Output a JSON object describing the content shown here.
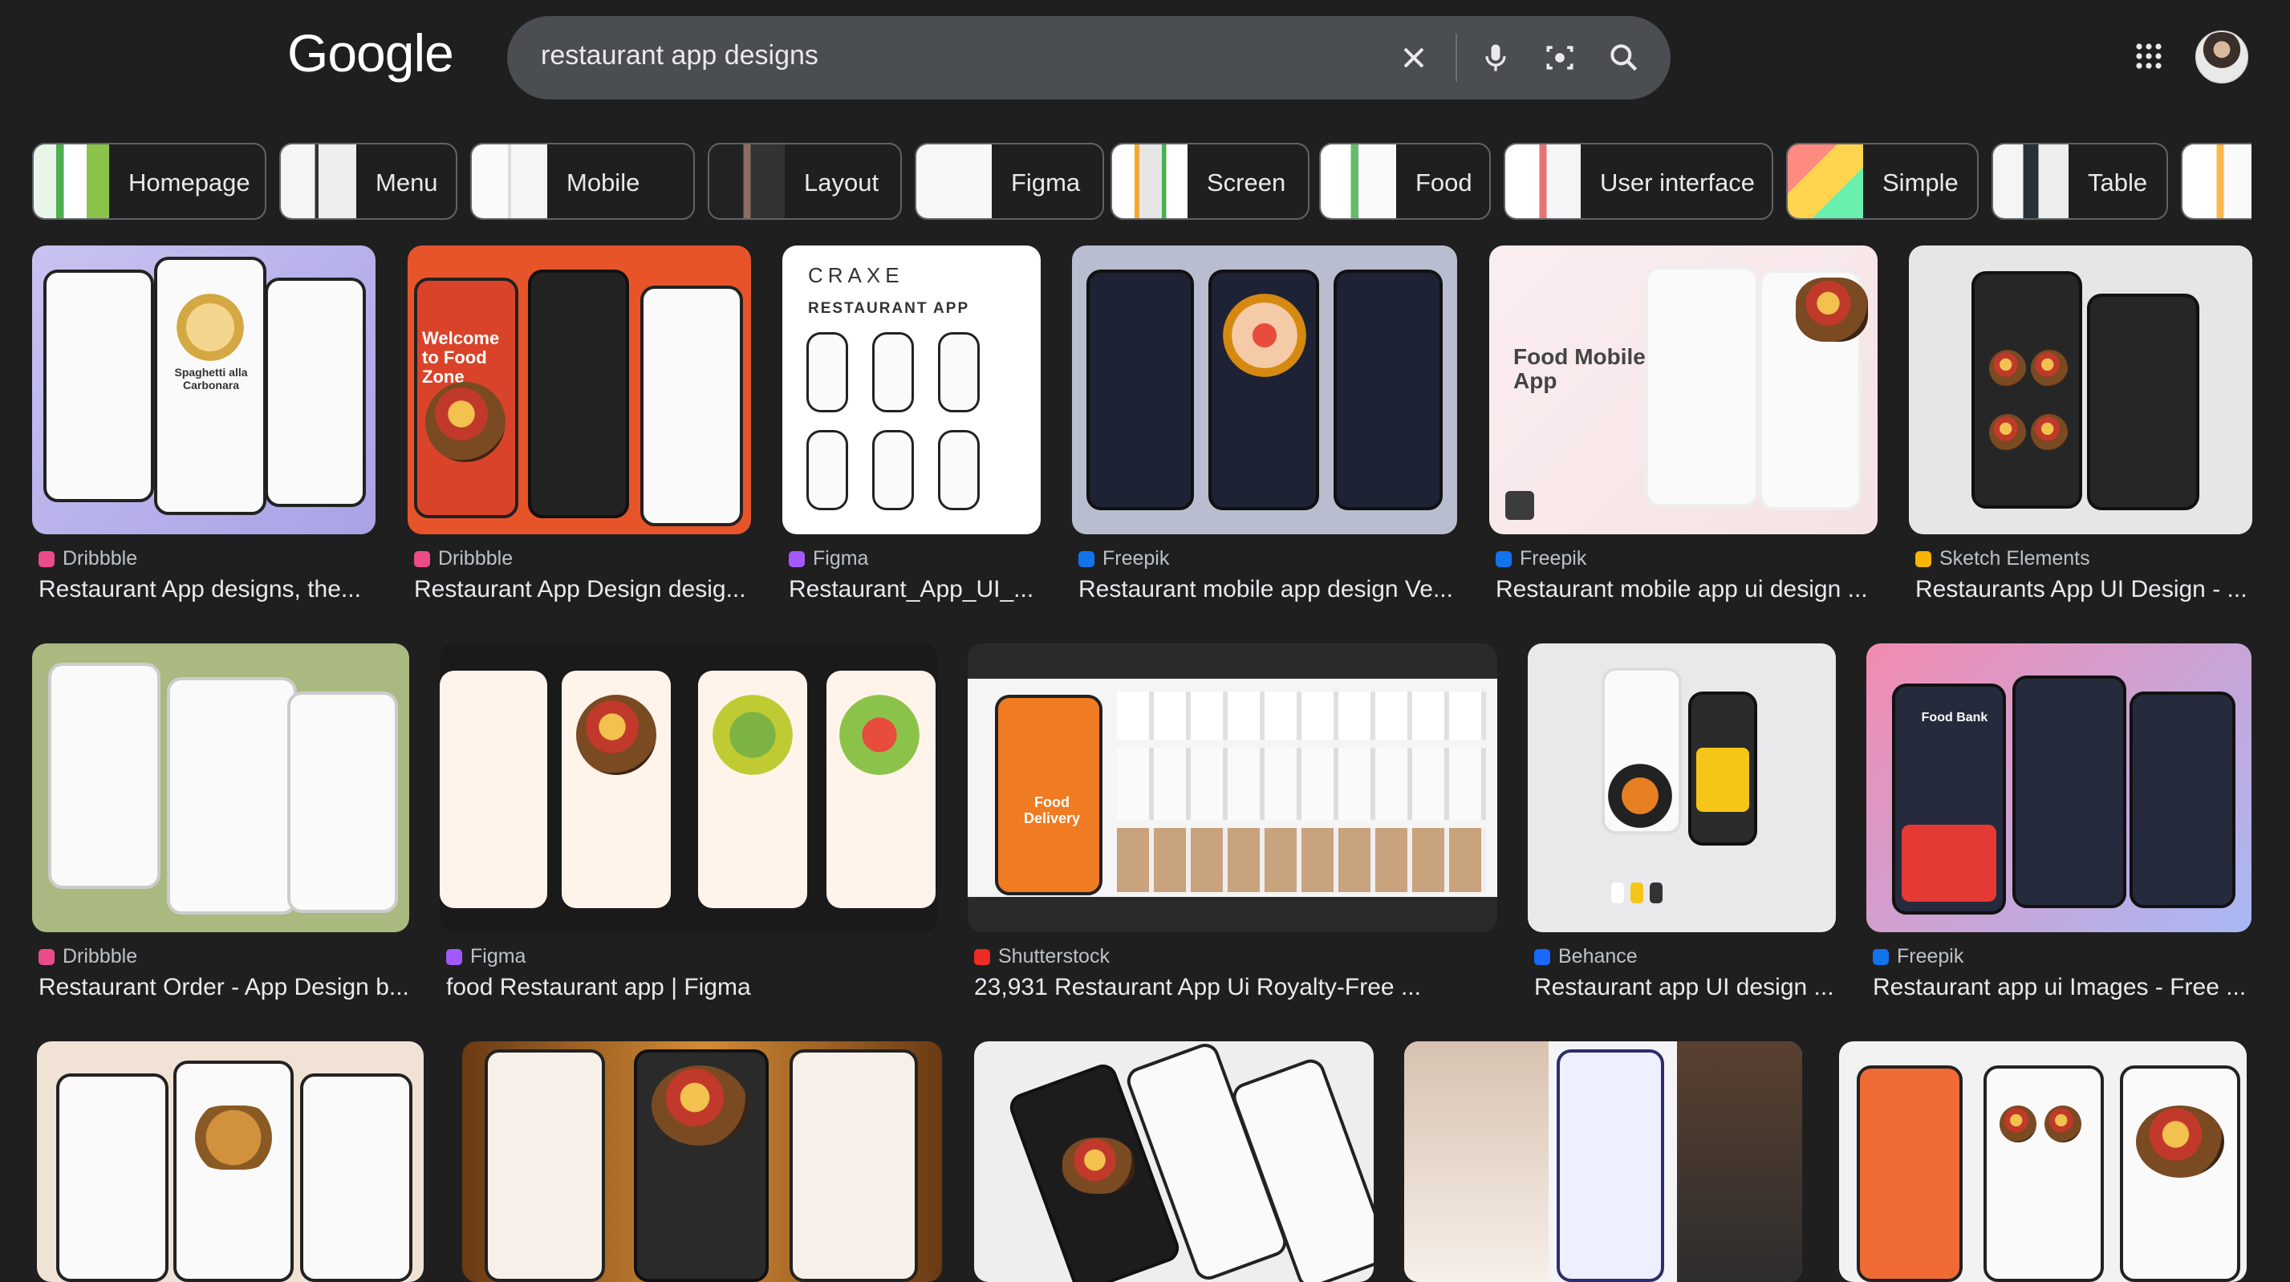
{
  "header": {
    "logo": "Google",
    "search_value": "restaurant app designs"
  },
  "chips": [
    {
      "label": "Homepage"
    },
    {
      "label": "Menu"
    },
    {
      "label": "Mobile"
    },
    {
      "label": "Layout"
    },
    {
      "label": "Figma"
    },
    {
      "label": "Screen"
    },
    {
      "label": "Food"
    },
    {
      "label": "User interface"
    },
    {
      "label": "Simple"
    },
    {
      "label": "Table"
    }
  ],
  "results": [
    {
      "source": "Dribbble",
      "title": "Restaurant App designs, the...",
      "fav_color": "#ea4c89",
      "thumb_text": "Spaghetti alla Carbonara"
    },
    {
      "source": "Dribbble",
      "title": "Restaurant App Design desig...",
      "fav_color": "#ea4c89",
      "thumb_text": "Welcome to Food Zone"
    },
    {
      "source": "Figma",
      "title": "Restaurant_App_UI_...",
      "fav_color": "#a259ff",
      "thumb_text": "RESTAURANT APP",
      "thumb_brand": "CRAXE"
    },
    {
      "source": "Freepik",
      "title": "Restaurant mobile app design Ve...",
      "fav_color": "#1273eb"
    },
    {
      "source": "Freepik",
      "title": "Restaurant mobile app ui design ...",
      "fav_color": "#1273eb",
      "thumb_text": "Food Mobile App"
    },
    {
      "source": "Sketch Elements",
      "title": "Restaurants App UI Design - ...",
      "fav_color": "#f7b500"
    },
    {
      "source": "Dribbble",
      "title": "Restaurant Order - App Design b...",
      "fav_color": "#ea4c89"
    },
    {
      "source": "Figma",
      "title": "food Restaurant app | Figma",
      "fav_color": "#a259ff"
    },
    {
      "source": "Shutterstock",
      "title": "23,931 Restaurant App Ui Royalty-Free ...",
      "fav_color": "#ee2b24",
      "thumb_text": "Food Delivery"
    },
    {
      "source": "Behance",
      "title": "Restaurant app UI design ...",
      "fav_color": "#1769ff"
    },
    {
      "source": "Freepik",
      "title": "Restaurant app ui Images - Free ...",
      "fav_color": "#1273eb",
      "thumb_text": "Food Bank"
    }
  ],
  "colors": {
    "background": "#1f1f1f",
    "search_bar": "#4a4d51",
    "text_primary": "#e8eaed",
    "text_secondary": "#bdc1c6",
    "chip_border": "#5f6368"
  }
}
